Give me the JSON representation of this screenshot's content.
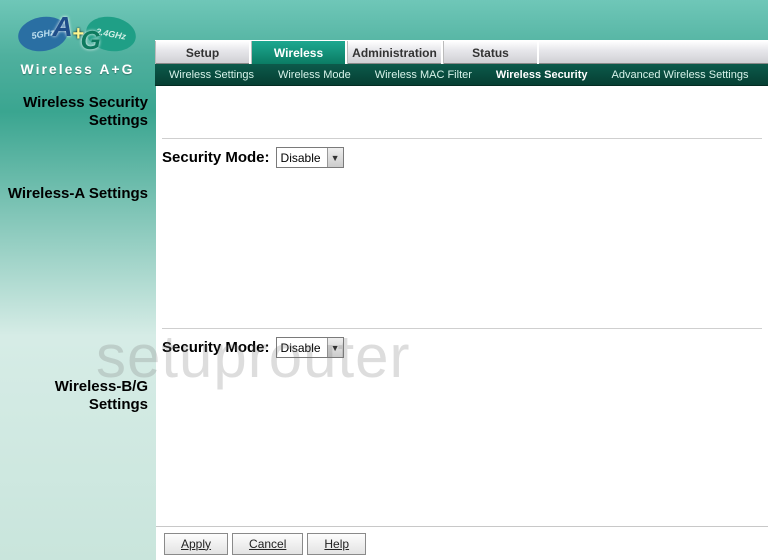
{
  "logo": {
    "band1": "5GHz",
    "band2": "2.4GHz",
    "letter1": "A",
    "plus": "+",
    "letter2": "G",
    "brand": "Wireless A+G"
  },
  "nav": {
    "tabs": [
      {
        "label": "Setup",
        "active": false
      },
      {
        "label": "Wireless",
        "active": true
      },
      {
        "label": "Administration",
        "active": false
      },
      {
        "label": "Status",
        "active": false
      }
    ],
    "subtabs": [
      {
        "label": "Wireless Settings",
        "active": false
      },
      {
        "label": "Wireless Mode",
        "active": false
      },
      {
        "label": "Wireless MAC Filter",
        "active": false
      },
      {
        "label": "Wireless Security",
        "active": true
      },
      {
        "label": "Advanced Wireless Settings",
        "active": false
      }
    ]
  },
  "page": {
    "title_line1": "Wireless Security",
    "title_line2": "Settings",
    "sectionA": "Wireless-A Settings",
    "sectionBG_line1": "Wireless-B/G",
    "sectionBG_line2": "Settings",
    "security_mode_label": "Security Mode:",
    "modeA": "Disable",
    "modeBG": "Disable"
  },
  "footer": {
    "apply": "Apply",
    "cancel": "Cancel",
    "help": "Help"
  },
  "watermark": "setuprouter"
}
